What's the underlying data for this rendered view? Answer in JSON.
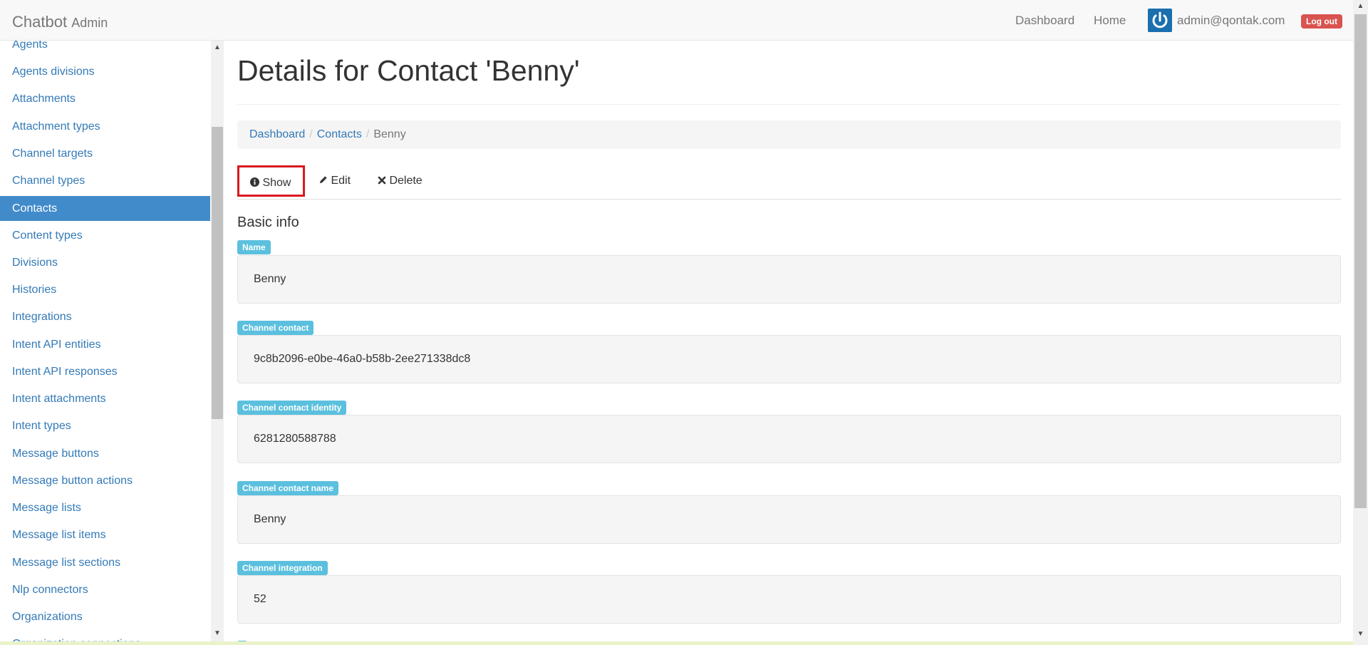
{
  "navbar": {
    "brand": "Chatbot",
    "brand_sub": "Admin",
    "links": [
      "Dashboard",
      "Home"
    ],
    "user_email": "admin@qontak.com",
    "logout_label": "Log out"
  },
  "sidebar": {
    "items": [
      {
        "label": "Agents"
      },
      {
        "label": "Agents divisions"
      },
      {
        "label": "Attachments"
      },
      {
        "label": "Attachment types"
      },
      {
        "label": "Channel targets"
      },
      {
        "label": "Channel types"
      },
      {
        "label": "Contacts",
        "active": true
      },
      {
        "label": "Content types"
      },
      {
        "label": "Divisions"
      },
      {
        "label": "Histories"
      },
      {
        "label": "Integrations"
      },
      {
        "label": "Intent API entities"
      },
      {
        "label": "Intent API responses"
      },
      {
        "label": "Intent attachments"
      },
      {
        "label": "Intent types"
      },
      {
        "label": "Message buttons"
      },
      {
        "label": "Message button actions"
      },
      {
        "label": "Message lists"
      },
      {
        "label": "Message list items"
      },
      {
        "label": "Message list sections"
      },
      {
        "label": "Nlp connectors"
      },
      {
        "label": "Organizations"
      },
      {
        "label": "Organization connections"
      }
    ]
  },
  "page": {
    "title": "Details for Contact 'Benny'"
  },
  "breadcrumb": {
    "items": [
      "Dashboard",
      "Contacts"
    ],
    "current": "Benny"
  },
  "tabs": {
    "show": "Show",
    "edit": "Edit",
    "delete": "Delete"
  },
  "section": {
    "title": "Basic info"
  },
  "fields": [
    {
      "label": "Name",
      "value": "Benny"
    },
    {
      "label": "Channel contact",
      "value": "9c8b2096-e0be-46a0-b58b-2ee271338dc8"
    },
    {
      "label": "Channel contact identity",
      "value": "6281280588788"
    },
    {
      "label": "Channel contact name",
      "value": "Benny"
    },
    {
      "label": "Channel integration",
      "value": "52"
    }
  ],
  "colors": {
    "link": "#337ab7",
    "active_bg": "#428bca",
    "badge": "#5bc0de",
    "logout": "#d9534f",
    "highlight_border": "#d9191f"
  }
}
